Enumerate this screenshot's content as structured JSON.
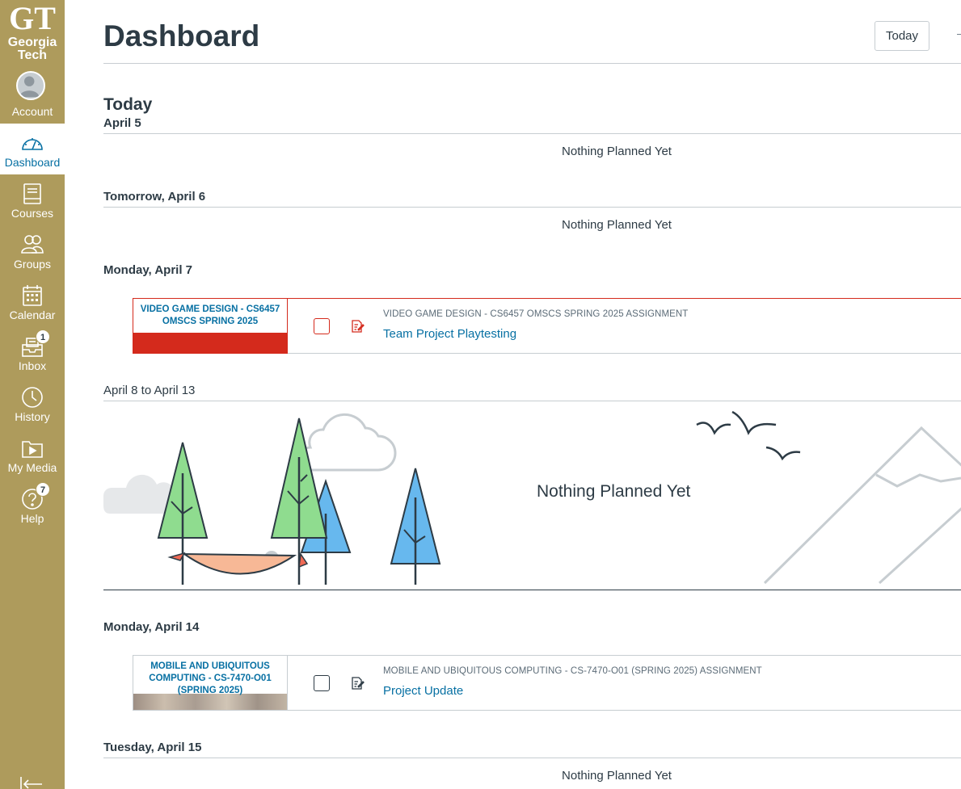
{
  "logo": {
    "line1": "Georgia",
    "line2": "Tech"
  },
  "sidebar": {
    "items": [
      {
        "label": "Account"
      },
      {
        "label": "Dashboard"
      },
      {
        "label": "Courses"
      },
      {
        "label": "Groups"
      },
      {
        "label": "Calendar"
      },
      {
        "label": "Inbox",
        "badge": "1"
      },
      {
        "label": "History"
      },
      {
        "label": "My Media"
      },
      {
        "label": "Help",
        "badge": "7"
      }
    ]
  },
  "header": {
    "title": "Dashboard",
    "today_button": "Today"
  },
  "days": [
    {
      "heading": "Today",
      "date": "April 5",
      "empty": "Nothing Planned Yet"
    },
    {
      "heading": "Tomorrow, April 6",
      "empty": "Nothing Planned Yet"
    },
    {
      "heading": "Monday, April 7",
      "item": {
        "course": "VIDEO GAME DESIGN - CS6457 OMSCS SPRING 2025",
        "context": "VIDEO GAME DESIGN - CS6457 OMSCS SPRING 2025 ASSIGNMENT",
        "title": "Team Project Playtesting"
      }
    },
    {
      "heading": "April 8 to April 13",
      "empty": "Nothing Planned Yet"
    },
    {
      "heading": "Monday, April 14",
      "item": {
        "course": "MOBILE AND UBIQUITOUS COMPUTING - CS-7470-O01 (SPRING 2025)",
        "context": "MOBILE AND UBIQUITOUS COMPUTING - CS-7470-O01 (SPRING 2025) ASSIGNMENT",
        "title": "Project Update"
      }
    },
    {
      "heading": "Tuesday, April 15",
      "empty": "Nothing Planned Yet"
    }
  ],
  "colors": {
    "sidebar": "#ae9b5c",
    "link": "#0770a3",
    "course_red": "#d42a1c"
  }
}
